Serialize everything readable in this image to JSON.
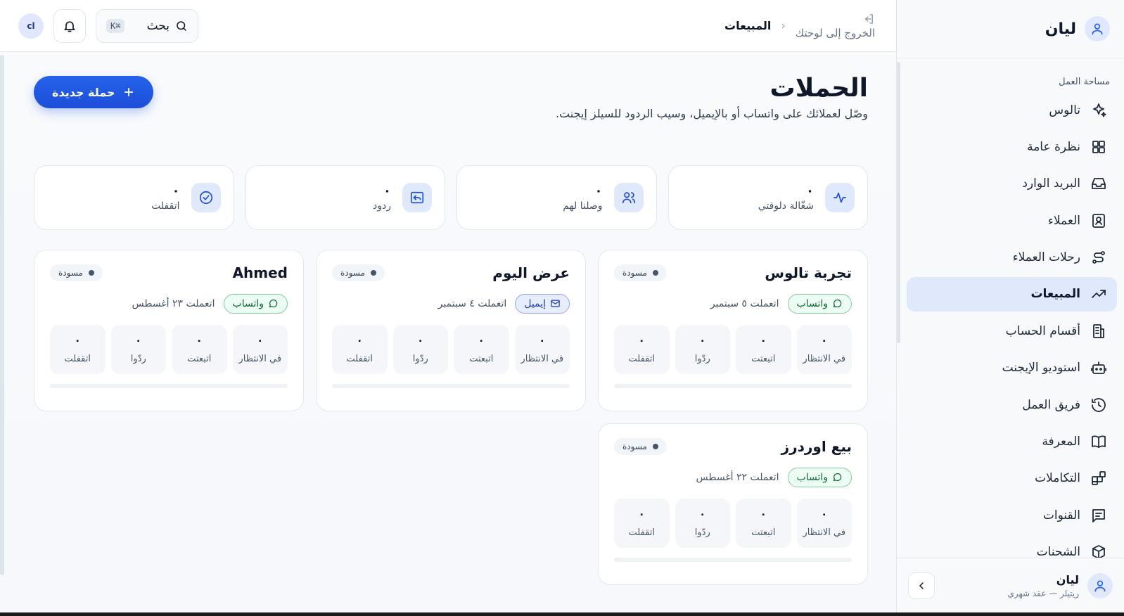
{
  "sidebar": {
    "workspace_name": "ليان",
    "section_label": "مساحة العمل",
    "items": [
      {
        "label": "تالوس",
        "icon": "sparkles-icon"
      },
      {
        "label": "نظرة عامة",
        "icon": "grid-icon"
      },
      {
        "label": "البريد الوارد",
        "icon": "inbox-icon"
      },
      {
        "label": "العملاء",
        "icon": "contact-icon"
      },
      {
        "label": "رحلات العملاء",
        "icon": "route-icon"
      },
      {
        "label": "المبيعات",
        "icon": "trending-up-icon",
        "active": true
      },
      {
        "label": "أقسام الحساب",
        "icon": "building-icon"
      },
      {
        "label": "استوديو الإيجنت",
        "icon": "bot-icon"
      },
      {
        "label": "فريق العمل",
        "icon": "history-icon"
      },
      {
        "label": "المعرفة",
        "icon": "book-icon"
      },
      {
        "label": "التكاملات",
        "icon": "blocks-icon"
      },
      {
        "label": "القنوات",
        "icon": "message-square-icon"
      },
      {
        "label": "الشحنات",
        "icon": "package-icon"
      }
    ],
    "footer": {
      "name": "ليان",
      "plan": "ريتيلر — عقد شهري"
    }
  },
  "topbar": {
    "exit_label": "الخروج إلى لوحتك",
    "breadcrumb_current": "المبيعات",
    "search_label": "بحث",
    "search_shortcut": "⌘K",
    "user_initials": "cl"
  },
  "page": {
    "title": "الحملات",
    "subtitle": "وصّل لعملائك على واتساب أو بالإيميل، وسيب الردود للسيلز إيجنت.",
    "new_button": "حملة جديدة"
  },
  "stats": [
    {
      "value": "٠",
      "label": "شغّالة دلوقتي",
      "icon": "activity-icon"
    },
    {
      "value": "٠",
      "label": "وصلنا لهم",
      "icon": "users-icon"
    },
    {
      "value": "٠",
      "label": "ردود",
      "icon": "reply-icon"
    },
    {
      "value": "٠",
      "label": "اتقفلت",
      "icon": "check-circle-icon"
    }
  ],
  "campaigns": [
    {
      "name": "تجربة تالوس",
      "status": "مسودة",
      "channel": "واتساب",
      "channel_type": "whatsapp",
      "created": "اتعملت ٥ سبتمبر",
      "progress_pct": 0,
      "metrics": [
        {
          "value": "٠",
          "label": "في الانتظار"
        },
        {
          "value": "٠",
          "label": "اتبعتت"
        },
        {
          "value": "٠",
          "label": "ردّوا"
        },
        {
          "value": "٠",
          "label": "اتقفلت"
        }
      ]
    },
    {
      "name": "عرض اليوم",
      "status": "مسودة",
      "channel": "إيميل",
      "channel_type": "email",
      "created": "اتعملت ٤ سبتمبر",
      "progress_pct": 0,
      "metrics": [
        {
          "value": "٠",
          "label": "في الانتظار"
        },
        {
          "value": "٠",
          "label": "اتبعتت"
        },
        {
          "value": "٠",
          "label": "ردّوا"
        },
        {
          "value": "٠",
          "label": "اتقفلت"
        }
      ]
    },
    {
      "name": "Ahmed",
      "status": "مسودة",
      "channel": "واتساب",
      "channel_type": "whatsapp",
      "created": "اتعملت ٢٣ أغسطس",
      "progress_pct": 0,
      "metrics": [
        {
          "value": "٠",
          "label": "في الانتظار"
        },
        {
          "value": "٠",
          "label": "اتبعتت"
        },
        {
          "value": "٠",
          "label": "ردّوا"
        },
        {
          "value": "٠",
          "label": "اتقفلت"
        }
      ]
    },
    {
      "name": "بيع اوردرز",
      "status": "مسودة",
      "channel": "واتساب",
      "channel_type": "whatsapp",
      "created": "اتعملت ٢٢ أغسطس",
      "progress_pct": 0,
      "metrics": [
        {
          "value": "٠",
          "label": "في الانتظار"
        },
        {
          "value": "٠",
          "label": "اتبعتت"
        },
        {
          "value": "٠",
          "label": "ردّوا"
        },
        {
          "value": "٠",
          "label": "اتقفلت"
        }
      ]
    }
  ],
  "colors": {
    "accent": "#2563eb",
    "active_bg": "#e0e8fb",
    "whatsapp": "#166534",
    "email": "#1e40af"
  }
}
